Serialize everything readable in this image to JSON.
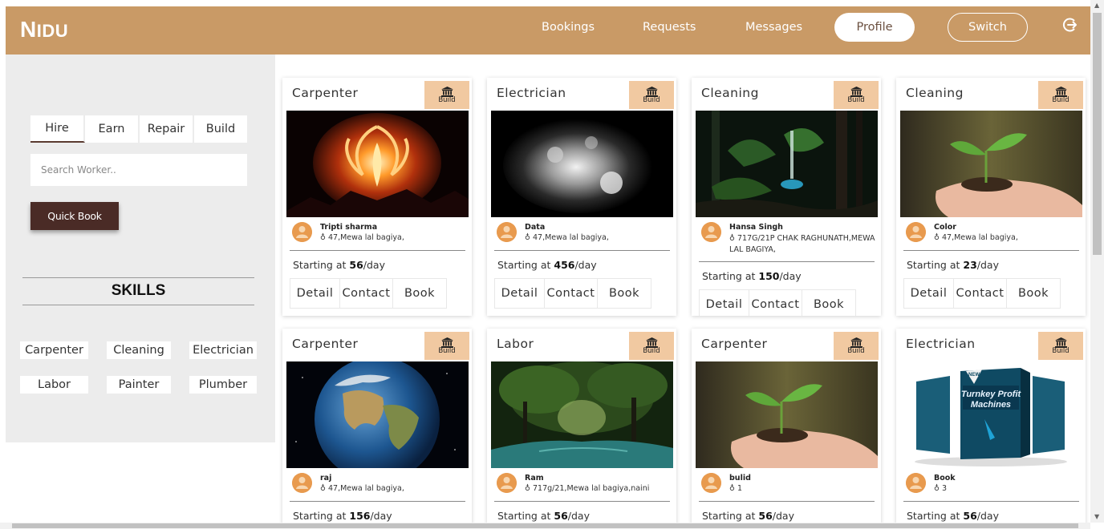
{
  "header": {
    "logo_big": "N",
    "logo_rest": "IDU",
    "nav": [
      "Bookings",
      "Requests",
      "Messages"
    ],
    "profile": "Profile",
    "switch": "Switch",
    "brand_color": "#c99a66"
  },
  "sidebar": {
    "tabs": [
      "Hire",
      "Earn",
      "Repair",
      "Build"
    ],
    "active_tab": "Hire",
    "search_placeholder": "Search Worker..",
    "quick_book": "Quick Book",
    "skills_title": "SKILLS",
    "skills": [
      "Carpenter",
      "Cleaning",
      "Electrician",
      "Labor",
      "Painter",
      "Plumber"
    ]
  },
  "card_ui": {
    "badge_label": "Build",
    "price_prefix": "Starting at ",
    "price_suffix": "/day",
    "actions": [
      "Detail",
      "Contact",
      "Book"
    ]
  },
  "cards": [
    {
      "category": "Carpenter",
      "image": "fire-phoenix",
      "name": "Tripti sharma",
      "address": "47,Mewa lal bagiya,",
      "price": "56"
    },
    {
      "category": "Electrician",
      "image": "white-splash",
      "name": "Data",
      "address": "47,Mewa lal bagiya,",
      "price": "456"
    },
    {
      "category": "Cleaning",
      "image": "forest-waterfall",
      "name": "Hansa Singh",
      "address": "717G/21P CHAK RAGHUNATH,MEWA LAL BAGIYA,",
      "price": "150"
    },
    {
      "category": "Cleaning",
      "image": "hand-sprout",
      "name": "Color",
      "address": "47,Mewa lal bagiya,",
      "price": "23"
    },
    {
      "category": "Carpenter",
      "image": "earth-globe",
      "name": "raj",
      "address": "47,Mewa lal bagiya,",
      "price": "156"
    },
    {
      "category": "Labor",
      "image": "forest-river",
      "name": "Ram",
      "address": "717g/21,Mewa lal bagiya,naini",
      "price": "56"
    },
    {
      "category": "Carpenter",
      "image": "hand-sprout",
      "name": "bulid",
      "address": "1",
      "price": "56"
    },
    {
      "category": "Electrician",
      "image": "ebook-boxes",
      "name": "Book",
      "address": "3",
      "price": "56"
    }
  ],
  "ebook_text": {
    "new": "NEW",
    "title_a": "Turnkey Profit",
    "title_b": "Machines"
  }
}
